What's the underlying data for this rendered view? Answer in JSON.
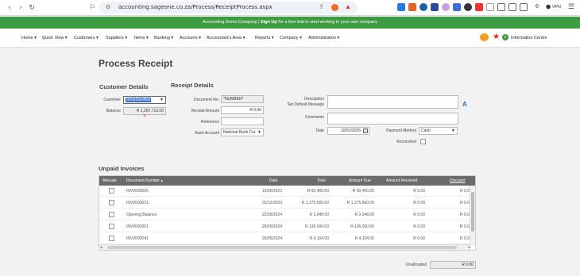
{
  "browser": {
    "url": "accounting.sageone.co.za/Process/ReceiptProcess.aspx",
    "vpn_label": "VPN"
  },
  "banner": {
    "prefix": "Accounting Demo Company |",
    "signup": "Sign Up",
    "suffix": "for a free trial to start working in your own company"
  },
  "menu": {
    "items": [
      "Home ▾",
      "Quick View ▾",
      "Customers ▾",
      "Suppliers ▾",
      "Items ▾",
      "Banking ▾",
      "Accounts ▾",
      "Accountant's Area ▾",
      "Reports ▾",
      "Company ▾",
      "Administration ▾"
    ],
    "info_centre": "Information Centre"
  },
  "page": {
    "title": "Process Receipt"
  },
  "customer": {
    "section": "Customer Details",
    "customer_label": "Customer",
    "customer_value": "ShopSandton",
    "balance_label": "Balance",
    "balance_value": "R 1,267,712.00"
  },
  "receipt": {
    "section": "Receipt Details",
    "doc_no_label": "Document No.",
    "doc_no_value": "*NUMBER*",
    "amount_label": "Receipt Amount",
    "amount_value": "R 0.00",
    "reference_label": "Reference",
    "reference_value": "",
    "bank_label": "Bank Account",
    "bank_value": "National Bank Cur"
  },
  "right": {
    "description_label": "Description",
    "default_msg_label": "Set Default Message",
    "comments_label": "Comments",
    "date_label": "Date",
    "date_value": "10/01/2025",
    "payment_label": "Payment Method",
    "payment_value": "Cash",
    "reconciled_label": "Reconciled"
  },
  "invoices": {
    "section": "Unpaid Invoices",
    "headers": [
      "Allocate",
      "Document Number ▴",
      "Date",
      "Total",
      "Amount Due",
      "Amount Received",
      "Discount"
    ],
    "rows": [
      {
        "doc": "INV0000026",
        "date": "15/06/2023",
        "total": "R 60,400.00",
        "due": "R 60,400.00",
        "received": "R 0.00",
        "discount": "R 0.0"
      },
      {
        "doc": "INV0000021",
        "date": "01/12/2023",
        "total": "R 1,275,660.00",
        "due": "R 1,275,660.00",
        "received": "R 0.00",
        "discount": "R 0.0"
      },
      {
        "doc": "Opening Balance",
        "date": "22/05/2024",
        "total": "R 5,948.00",
        "due": "R 3,948.00",
        "received": "R 0.00",
        "discount": "R 0.0"
      },
      {
        "doc": "INV0000051",
        "date": "26/05/2024",
        "total": "R 136,000.00",
        "due": "R 136,000.00",
        "received": "R 0.00",
        "discount": "R 0.0"
      },
      {
        "doc": "INV0000041",
        "date": "26/05/2024",
        "total": "R 4,104.00",
        "due": "R 4,104.00",
        "received": "R 0.00",
        "discount": "R 0.0"
      }
    ],
    "unallocated_label": "Unallocated",
    "unallocated_value": "R 0.00"
  }
}
